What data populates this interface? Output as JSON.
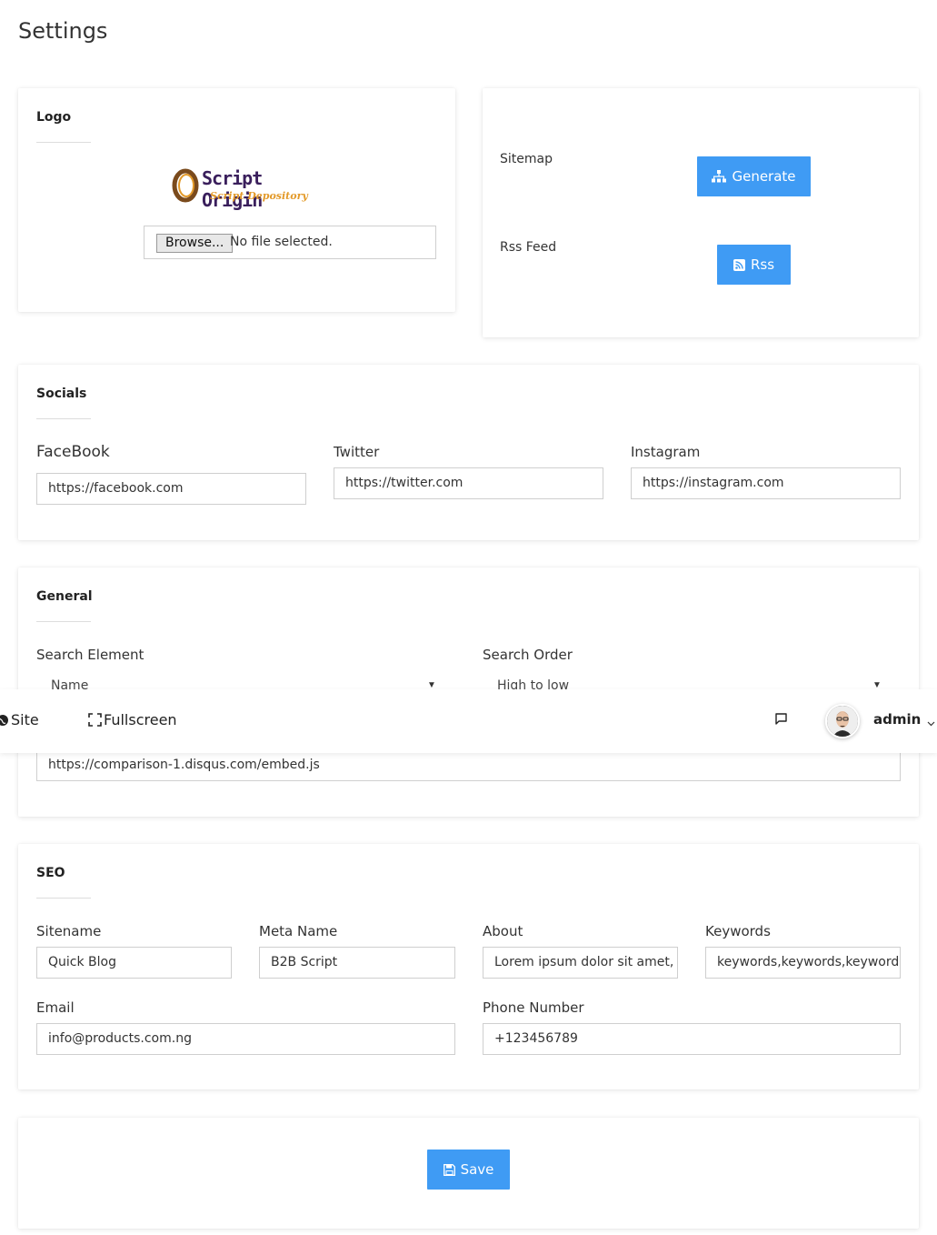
{
  "page": {
    "title": "Settings"
  },
  "logo_card": {
    "title": "Logo",
    "logo_text": "Script Origin",
    "logo_subtext": "Script Depository",
    "file_button": "Browse...",
    "file_status": "No file selected."
  },
  "tools_card": {
    "sitemap_label": "Sitemap",
    "generate_label": "Generate",
    "rss_label": "Rss Feed",
    "rss_button": "Rss"
  },
  "socials": {
    "title": "Socials",
    "facebook_label": "FaceBook",
    "facebook_value": "https://facebook.com",
    "twitter_label": "Twitter",
    "twitter_value": "https://twitter.com",
    "instagram_label": "Instagram",
    "instagram_value": "https://instagram.com"
  },
  "general": {
    "title": "General",
    "search_element_label": "Search Element",
    "search_element_value": "Name",
    "search_order_label": "Search Order",
    "search_order_value": "High to low",
    "disqus_value": "https://comparison-1.disqus.com/embed.js"
  },
  "topbar": {
    "site_label": "Site",
    "fullscreen_label": "Fullscreen",
    "user_name": "admin"
  },
  "seo": {
    "title": "SEO",
    "sitename_label": "Sitename",
    "sitename_value": "Quick Blog",
    "metaname_label": "Meta Name",
    "metaname_value": "B2B Script",
    "about_label": "About",
    "about_value": "Lorem ipsum dolor sit amet, c",
    "keywords_label": "Keywords",
    "keywords_value": "keywords,keywords,keywords",
    "email_label": "Email",
    "email_value": "info@products.com.ng",
    "phone_label": "Phone Number",
    "phone_value": "+123456789"
  },
  "actions": {
    "save_label": "Save"
  },
  "colors": {
    "primary": "#3f9bf4",
    "logo_purple": "#3a1f5c",
    "logo_orange": "#e39a2a"
  }
}
